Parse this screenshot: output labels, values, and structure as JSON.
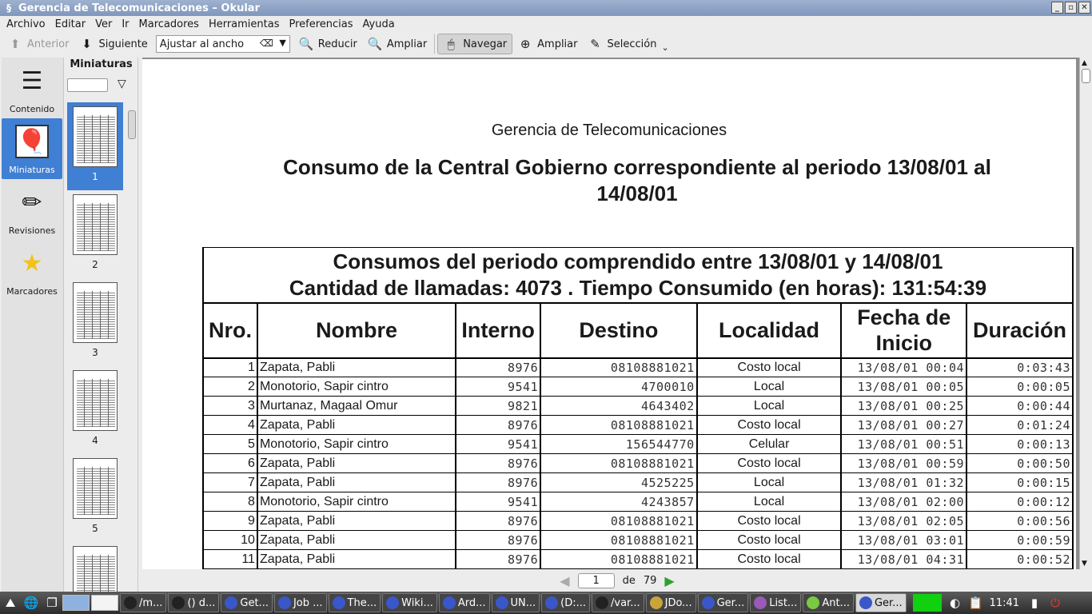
{
  "window": {
    "title": "Gerencia de Telecomunicaciones – Okular"
  },
  "menubar": [
    "Archivo",
    "Editar",
    "Ver",
    "Ir",
    "Marcadores",
    "Herramientas",
    "Preferencias",
    "Ayuda"
  ],
  "toolbar": {
    "prev_label": "Anterior",
    "next_label": "Siguiente",
    "zoom_value": "Ajustar al ancho",
    "zoom_out_label": "Reducir",
    "zoom_in_label": "Ampliar",
    "browse_label": "Navegar",
    "magnify_label": "Ampliar",
    "select_label": "Selección"
  },
  "sidebar": {
    "items": [
      {
        "label": "Contenido"
      },
      {
        "label": "Miniaturas"
      },
      {
        "label": "Revisiones"
      },
      {
        "label": "Marcadores"
      }
    ]
  },
  "thumbnails": {
    "heading": "Miniaturas",
    "pages": [
      "1",
      "2",
      "3",
      "4",
      "5"
    ]
  },
  "document": {
    "org_title": "Gerencia de Telecomunicaciones",
    "report_title": "Consumo de la Central Gobierno correspondiente al periodo 13/08/01 al 14/08/01",
    "summary_line1": "Consumos del periodo comprendido entre 13/08/01 y 14/08/01",
    "summary_line2": "Cantidad de llamadas: 4073 . Tiempo Consumido (en horas): 131:54:39",
    "columns": [
      "Nro.",
      "Nombre",
      "Interno",
      "Destino",
      "Localidad",
      "Fecha de Inicio",
      "Duración"
    ],
    "rows": [
      [
        "1",
        "Zapata, Pabli",
        "8976",
        "08108881021",
        "Costo local",
        "13/08/01 00:04",
        "0:03:43"
      ],
      [
        "2",
        "Monotorio, Sapir cintro",
        "9541",
        "4700010",
        "Local",
        "13/08/01 00:05",
        "0:00:05"
      ],
      [
        "3",
        "Murtanaz, Magaal Omur",
        "9821",
        "4643402",
        "Local",
        "13/08/01 00:25",
        "0:00:44"
      ],
      [
        "4",
        "Zapata, Pabli",
        "8976",
        "08108881021",
        "Costo local",
        "13/08/01 00:27",
        "0:01:24"
      ],
      [
        "5",
        "Monotorio, Sapir cintro",
        "9541",
        "156544770",
        "Celular",
        "13/08/01 00:51",
        "0:00:13"
      ],
      [
        "6",
        "Zapata, Pabli",
        "8976",
        "08108881021",
        "Costo local",
        "13/08/01 00:59",
        "0:00:50"
      ],
      [
        "7",
        "Zapata, Pabli",
        "8976",
        "4525225",
        "Local",
        "13/08/01 01:32",
        "0:00:15"
      ],
      [
        "8",
        "Monotorio, Sapir cintro",
        "9541",
        "4243857",
        "Local",
        "13/08/01 02:00",
        "0:00:12"
      ],
      [
        "9",
        "Zapata, Pabli",
        "8976",
        "08108881021",
        "Costo local",
        "13/08/01 02:05",
        "0:00:56"
      ],
      [
        "10",
        "Zapata, Pabli",
        "8976",
        "08108881021",
        "Costo local",
        "13/08/01 03:01",
        "0:00:59"
      ],
      [
        "11",
        "Zapata, Pabli",
        "8976",
        "08108881021",
        "Costo local",
        "13/08/01 04:31",
        "0:00:52"
      ]
    ]
  },
  "pagenav": {
    "current": "1",
    "of_label": "de",
    "total": "79"
  },
  "taskbar": {
    "tasks": [
      "/m...",
      "() d...",
      "Get...",
      "Job ...",
      "The...",
      "Wiki...",
      "Ard...",
      "UN...",
      "(D:...",
      "/var...",
      "JDo...",
      "Ger...",
      "List...",
      "Ant...",
      "Ger..."
    ],
    "active_task": 14,
    "clock": "11:41"
  },
  "colors": {
    "selection": "#3f7fd4",
    "titlebar": "#8ea4c8"
  }
}
